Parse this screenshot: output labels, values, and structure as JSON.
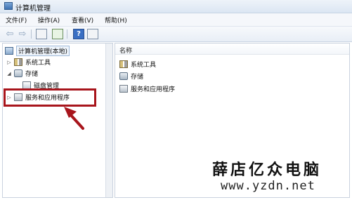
{
  "window": {
    "title": "计算机管理",
    "icon": "computer-management-icon"
  },
  "menu": [
    {
      "label": "文件(F)"
    },
    {
      "label": "操作(A)"
    },
    {
      "label": "查看(V)"
    },
    {
      "label": "帮助(H)"
    }
  ],
  "toolbar": {
    "buttons": [
      "back-arrow-icon",
      "forward-arrow-icon",
      "show-console-tree-icon",
      "export-list-icon",
      "help-icon",
      "properties-icon"
    ]
  },
  "tree": {
    "root": {
      "label": "计算机管理(本地)",
      "icon": "computer-icon"
    },
    "items": [
      {
        "label": "系统工具",
        "icon": "tools-icon",
        "expander": "▷"
      },
      {
        "label": "存储",
        "icon": "storage-icon",
        "expander": "◢"
      },
      {
        "label": "磁盘管理",
        "icon": "disk-icon",
        "expander": ""
      },
      {
        "label": "服务和应用程序",
        "icon": "services-icon",
        "expander": "▷"
      }
    ]
  },
  "list": {
    "column_header": "名称",
    "rows": [
      {
        "label": "系统工具",
        "icon": "tools-icon"
      },
      {
        "label": "存储",
        "icon": "storage-icon"
      },
      {
        "label": "服务和应用程序",
        "icon": "services-icon"
      }
    ]
  },
  "annotation": {
    "color": "#a8151c"
  },
  "watermark": {
    "name": "薛店亿众电脑",
    "url": "www.yzdn.net"
  }
}
